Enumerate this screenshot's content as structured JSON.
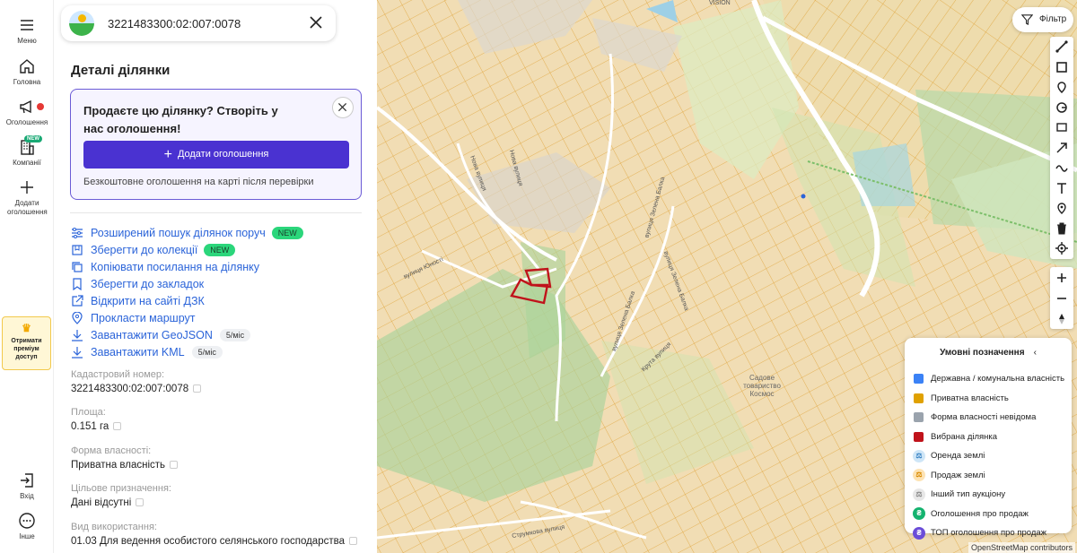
{
  "rail": {
    "menu": "Меню",
    "home": "Головна",
    "ads": "Оголошення",
    "companies": "Компанії",
    "companies_badge": "NEW",
    "add_ad": "Додати оголошення",
    "premium": "Отримати преміум доступ",
    "login": "Вхід",
    "more": "Інше"
  },
  "search": {
    "value": "3221483300:02:007:0078"
  },
  "details": {
    "title": "Деталі ділянки"
  },
  "promo": {
    "title": "Продаєте цю ділянку? Створіть у нас оголошення!",
    "button": "Додати оголошення",
    "note": "Безкоштовне оголошення на карті після перевірки"
  },
  "actions": [
    {
      "label": "Розширений пошук ділянок поруч",
      "badge": "NEW"
    },
    {
      "label": "Зберегти до колекції",
      "badge": "NEW"
    },
    {
      "label": "Копіювати посилання на ділянку"
    },
    {
      "label": "Зберегти до закладок"
    },
    {
      "label": "Відкрити на сайті ДЗК"
    },
    {
      "label": "Прокласти маршрут"
    },
    {
      "label": "Завантажити GeoJSON",
      "limit": "5/міс"
    },
    {
      "label": "Завантажити KML",
      "limit": "5/міс"
    }
  ],
  "fields": {
    "cadastral_label": "Кадастровий номер:",
    "cadastral_value": "3221483300:02:007:0078",
    "area_label": "Площа:",
    "area_value": "0.151 га",
    "ownership_label": "Форма власності:",
    "ownership_value": "Приватна власність",
    "purpose_label": "Цільове призначення:",
    "purpose_value": "Дані відсутні",
    "usage_label": "Вид використання:",
    "usage_value": "01.03 Для ведення особистого селянського господарства"
  },
  "map": {
    "filter": "Фільтр",
    "attribution": "OpenStreetMap contributors",
    "streets": [
      "вулиця Юності",
      "Нова вулиця",
      "Нова вулиця",
      "вулиця Зелена Балка",
      "вулиця Зелена Балка",
      "вулиця Зелена Балка",
      "Крута вулиця",
      "Садове товариство Космос",
      "Струмкова вулиця",
      "VISION"
    ]
  },
  "legend": {
    "title": "Умовні позначення",
    "items": [
      {
        "label": "Державна / комунальна власність",
        "color": "#3b82f6"
      },
      {
        "label": "Приватна власність",
        "color": "#e0a100"
      },
      {
        "label": "Форма власності невідома",
        "color": "#9aa3ad"
      },
      {
        "label": "Вибрана ділянка",
        "color": "#c0131b"
      },
      {
        "label": "Оренда землі",
        "color": "#7fb7e6"
      },
      {
        "label": "Продаж землі",
        "color": "#f5a623"
      },
      {
        "label": "Інший тип аукціону",
        "color": "#b9b9b9"
      },
      {
        "label": "Оголошення про продаж",
        "color": "#14b36f"
      },
      {
        "label": "ТОП оголошення про продаж",
        "color": "#6b4dd8"
      }
    ]
  }
}
